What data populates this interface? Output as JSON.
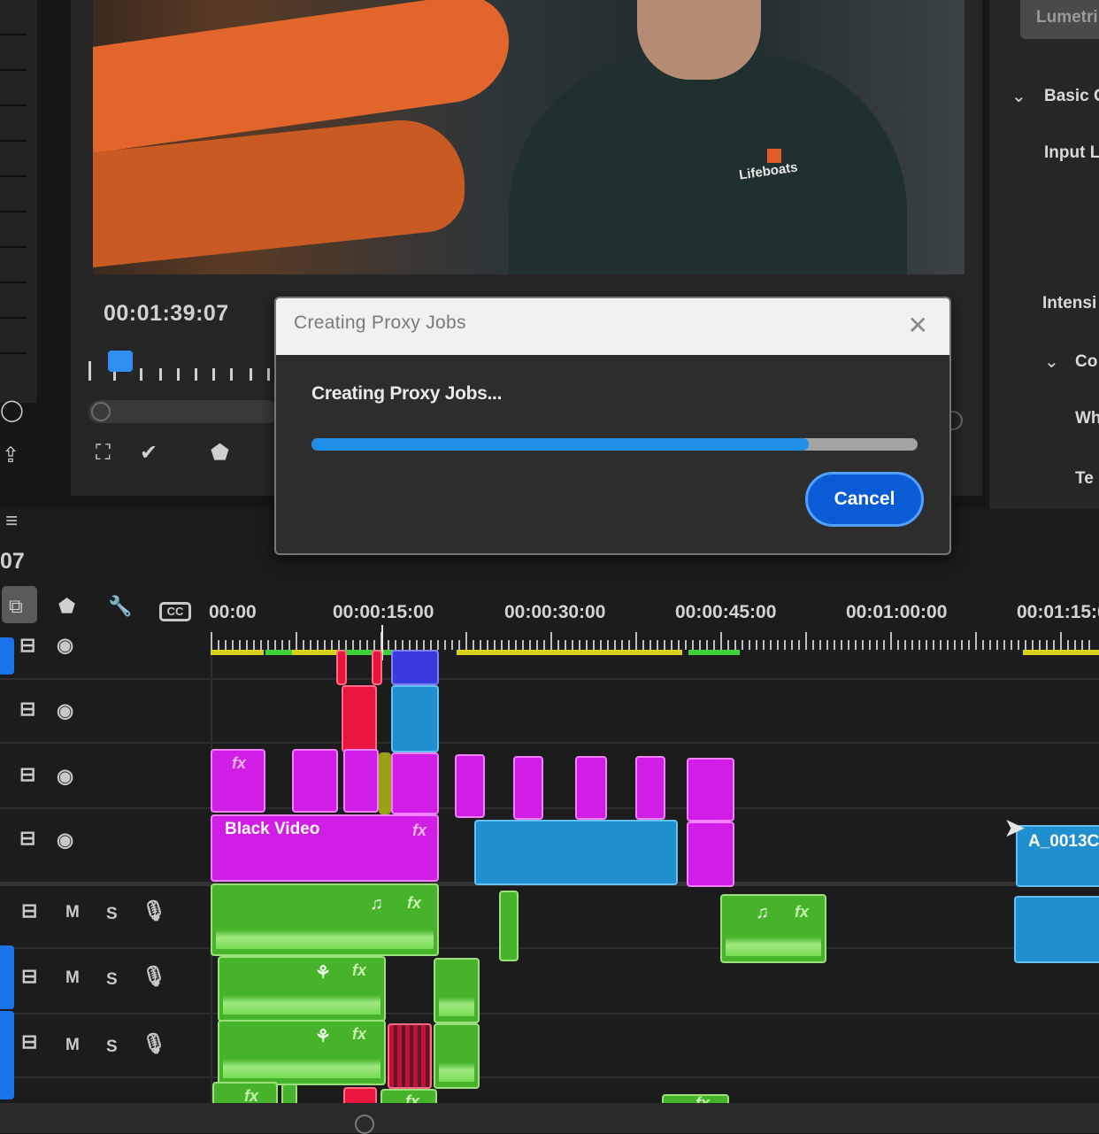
{
  "monitor": {
    "timecode": "00:01:39:07",
    "logo_text": "Lifeboats"
  },
  "right_panel": {
    "tab_label": "Lumetri",
    "section_basic": "Basic C",
    "input_label": "Input L",
    "intensity_label": "Intensi",
    "section_creative": "Co",
    "white_label": "Wh",
    "temp_label": "Te"
  },
  "timeline": {
    "timecode": "07",
    "ruler_labels": [
      "00:00",
      "00:00:15:00",
      "00:00:30:00",
      "00:00:45:00",
      "00:01:00:00",
      "00:01:15:00"
    ],
    "tracks": [
      {
        "id": "V3",
        "type": "video"
      },
      {
        "id": "V2",
        "type": "video"
      },
      {
        "id": "V1",
        "type": "video"
      },
      {
        "id": "A1",
        "type": "audio",
        "m": "M",
        "s": "S"
      },
      {
        "id": "A2",
        "type": "audio",
        "m": "M",
        "s": "S"
      },
      {
        "id": "A3",
        "type": "audio",
        "m": "M",
        "s": "S"
      }
    ],
    "clip_labels": {
      "black_video": "Black Video",
      "a_clip": "A_0013C",
      "fx": "fx"
    },
    "colors": {
      "magenta": "#d01ee6",
      "blue": "#1f8fd0",
      "green": "#46b32a",
      "red": "#e8153f",
      "yellow_bar": "#d8d21a"
    }
  },
  "dialog": {
    "title": "Creating Proxy Jobs",
    "message": "Creating Proxy Jobs...",
    "progress": 0.82,
    "cancel_label": "Cancel",
    "close_icon": "close-icon"
  }
}
